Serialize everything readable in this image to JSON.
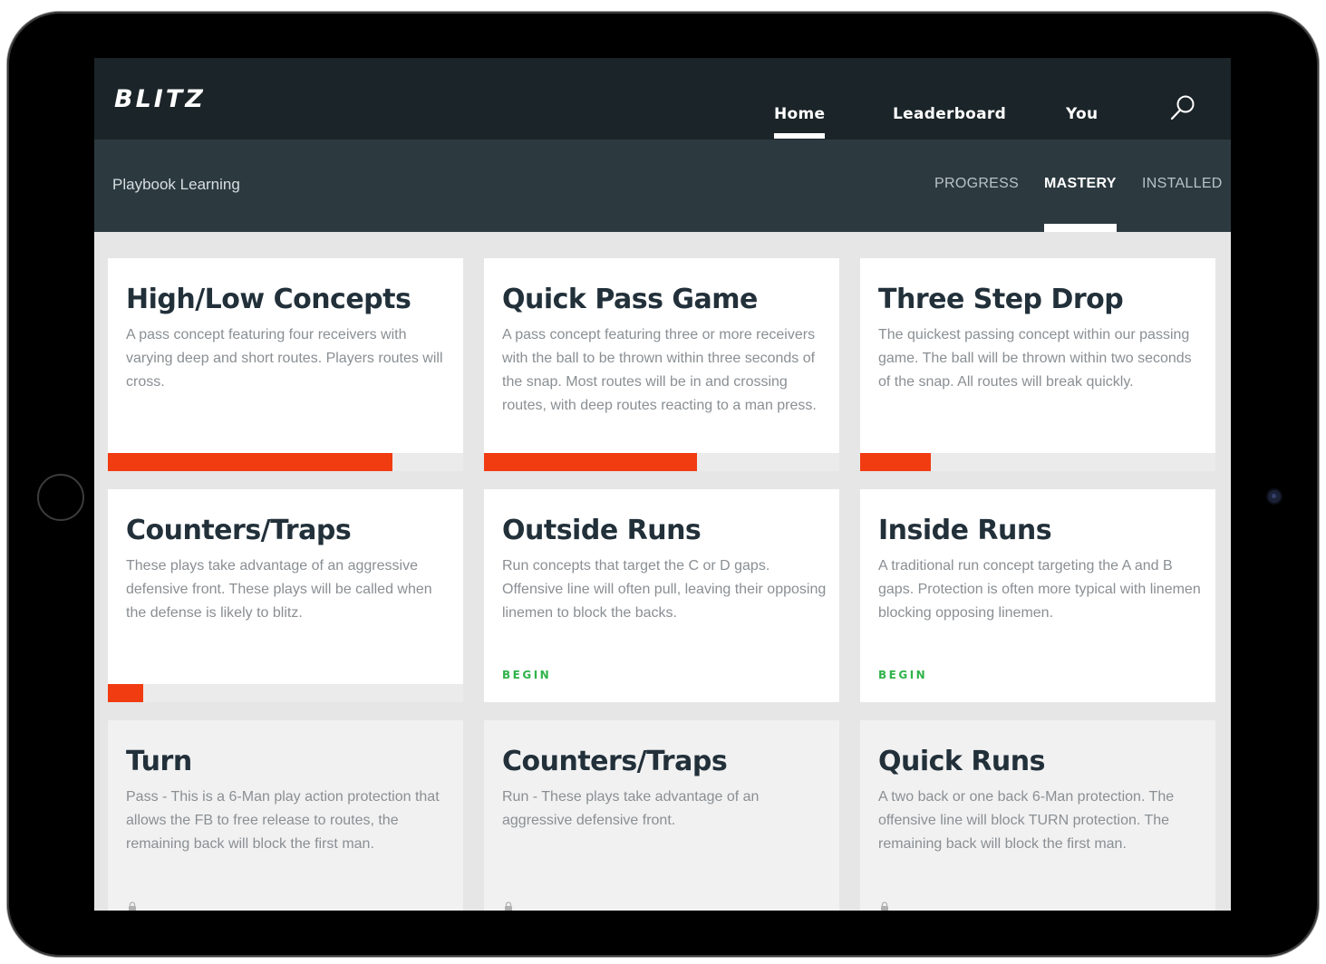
{
  "app": {
    "logo": "BLITZ"
  },
  "nav": {
    "items": [
      {
        "label": "Home",
        "active": true
      },
      {
        "label": "Leaderboard",
        "active": false
      },
      {
        "label": "You",
        "active": false
      }
    ],
    "search_icon": "search-icon"
  },
  "subbar": {
    "title": "Playbook Learning",
    "tabs": [
      {
        "label": "PROGRESS",
        "active": false
      },
      {
        "label": "MASTERY",
        "active": true
      },
      {
        "label": "INSTALLED",
        "active": false
      }
    ]
  },
  "colors": {
    "progress": "#f13c12",
    "begin": "#2fb34a",
    "header": "#1b2428",
    "subheader": "#2c3a40"
  },
  "cards": [
    {
      "title": "High/Low Concepts",
      "description": "A pass concept featuring four receivers with varying deep and short routes. Players routes will cross.",
      "progress": 0.8
    },
    {
      "title": "Quick Pass Game",
      "description": "A pass concept featuring three or more receivers with the ball to be thrown within three seconds of the snap. Most routes will be in and crossing routes, with deep routes reacting to a man press.",
      "progress": 0.6
    },
    {
      "title": "Three Step Drop",
      "description": "The quickest passing concept within our passing game. The ball will be thrown within two seconds of the snap. All routes will break quickly.",
      "progress": 0.2
    },
    {
      "title": "Counters/Traps",
      "description": "These plays take advantage of an aggressive defensive front. These plays will be called when the defense is likely to blitz.",
      "progress": 0.1
    },
    {
      "title": "Outside Runs",
      "description": "Run concepts that target the C or D gaps. Offensive line will often pull, leaving their opposing linemen to block the backs.",
      "action": "BEGIN"
    },
    {
      "title": "Inside Runs",
      "description": "A traditional run concept targeting the A and B gaps. Protection is often more typical with linemen blocking opposing linemen.",
      "action": "BEGIN"
    },
    {
      "title": "Turn",
      "description": "Pass - This is a 6-Man play action protection that allows the FB to free release to routes, the remaining back will block the first man.",
      "locked": true
    },
    {
      "title": "Counters/Traps",
      "description": "Run - These plays take advantage of an aggressive defensive front.",
      "locked": true
    },
    {
      "title": "Quick Runs",
      "description": "A two back or one back 6-Man protection. The offensive line will block TURN protection. The remaining back will block the first man.",
      "locked": true
    }
  ]
}
